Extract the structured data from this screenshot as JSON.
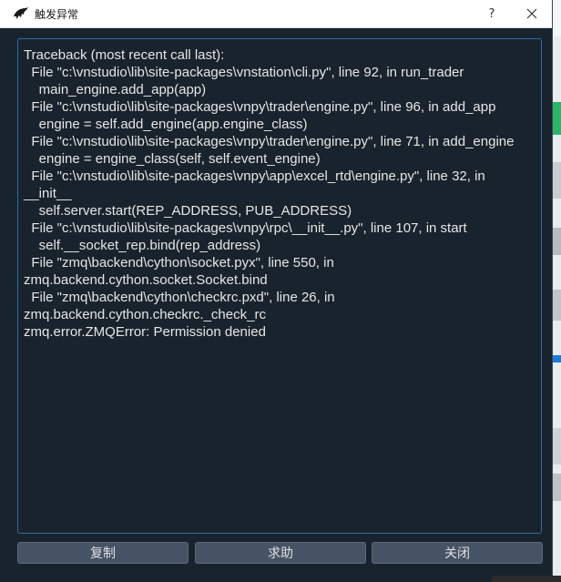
{
  "window": {
    "title": "触发异常",
    "help_label": "?",
    "close_icon": "close-icon",
    "app_icon": "vnpy-logo-icon"
  },
  "traceback": {
    "lines": [
      "Traceback (most recent call last):",
      "  File \"c:\\vnstudio\\lib\\site-packages\\vnstation\\cli.py\", line 92, in run_trader",
      "    main_engine.add_app(app)",
      "  File \"c:\\vnstudio\\lib\\site-packages\\vnpy\\trader\\engine.py\", line 96, in add_app",
      "    engine = self.add_engine(app.engine_class)",
      "  File \"c:\\vnstudio\\lib\\site-packages\\vnpy\\trader\\engine.py\", line 71, in add_engine",
      "    engine = engine_class(self, self.event_engine)",
      "  File \"c:\\vnstudio\\lib\\site-packages\\vnpy\\app\\excel_rtd\\engine.py\", line 32, in",
      "__init__",
      "    self.server.start(REP_ADDRESS, PUB_ADDRESS)",
      "  File \"c:\\vnstudio\\lib\\site-packages\\vnpy\\rpc\\__init__.py\", line 107, in start",
      "    self.__socket_rep.bind(rep_address)",
      "  File \"zmq\\backend\\cython\\socket.pyx\", line 550, in",
      "zmq.backend.cython.socket.Socket.bind",
      "  File \"zmq\\backend\\cython\\checkrc.pxd\", line 26, in",
      "zmq.backend.cython.checkrc._check_rc",
      "zmq.error.ZMQError: Permission denied"
    ]
  },
  "buttons": {
    "copy": "复制",
    "help": "求助",
    "close": "关闭"
  },
  "colors": {
    "background": "#19232d",
    "text": "#e6e6e6",
    "border_accent": "#2f6fa8",
    "button_bg": "#455364"
  }
}
